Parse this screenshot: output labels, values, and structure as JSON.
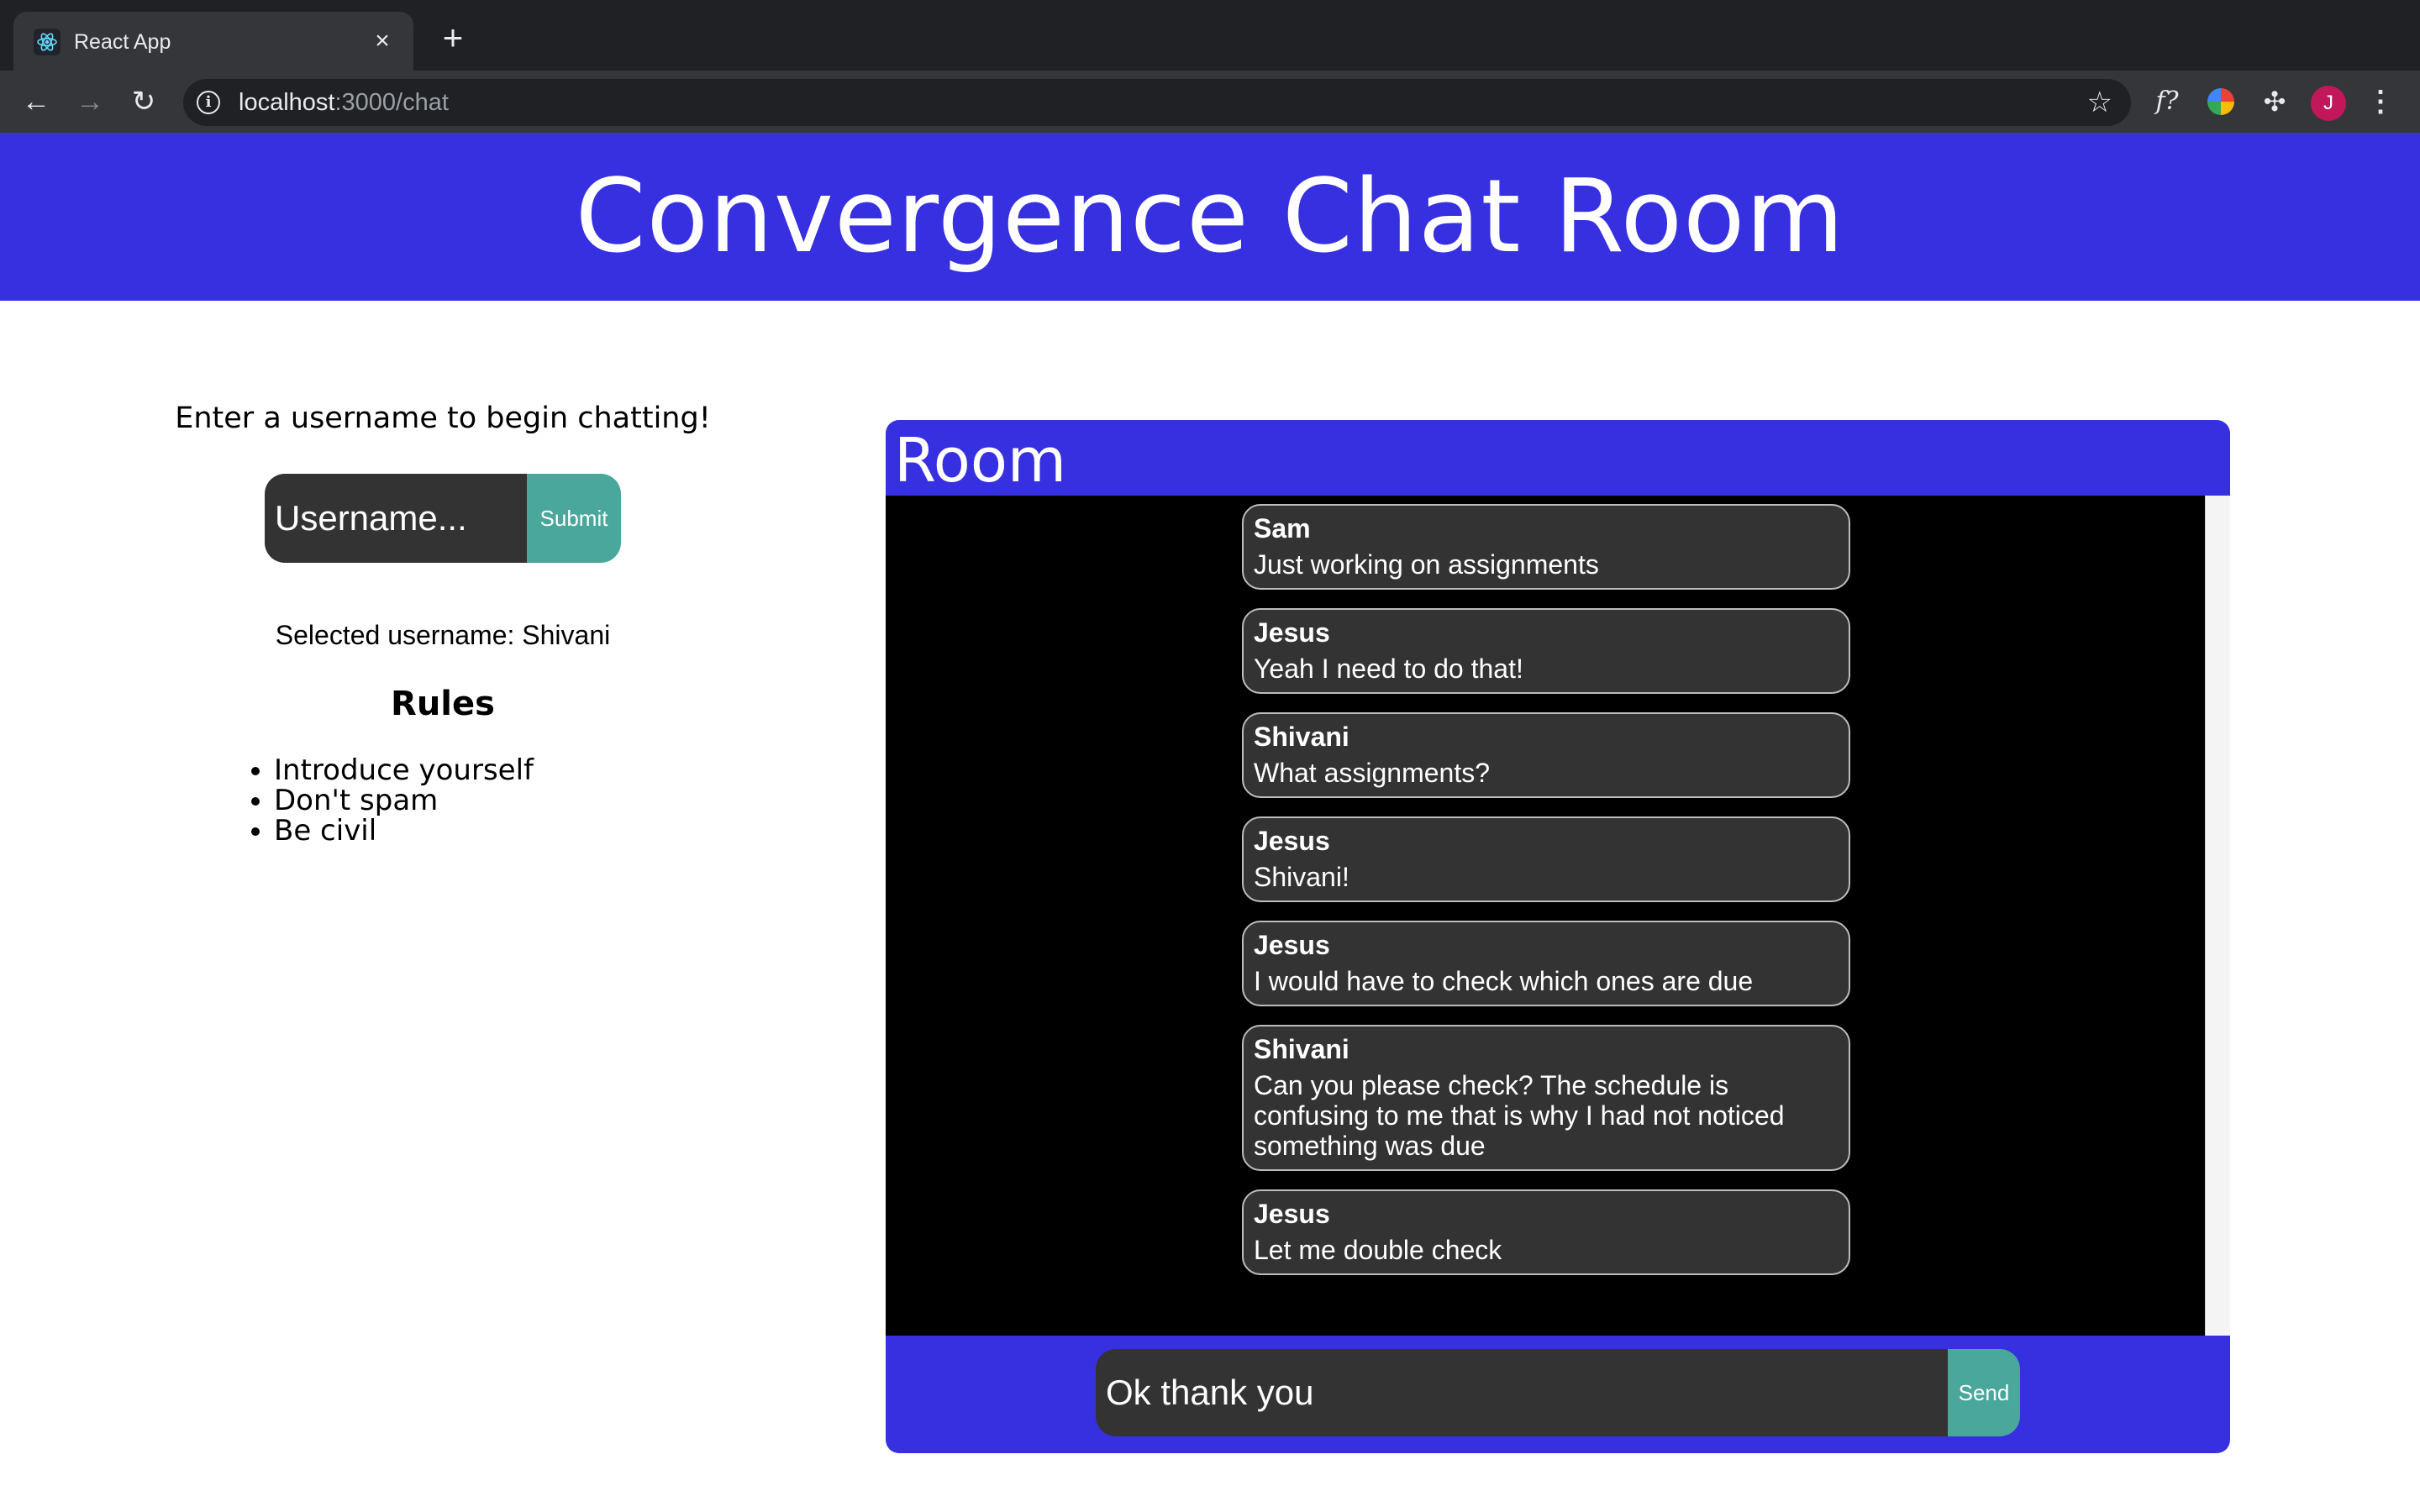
{
  "browser": {
    "tab_title": "React App",
    "tab_close_icon": "close-icon",
    "new_tab_icon": "plus-icon",
    "url_host": "localhost",
    "url_path": ":3000/chat",
    "avatar_letter": "J",
    "ext_f_label": "f?"
  },
  "header": {
    "title": "Convergence Chat Room"
  },
  "left": {
    "prompt": "Enter a username to begin chatting!",
    "username_placeholder": "Username...",
    "submit_label": "Submit",
    "selected_label": "Selected username: Shivani",
    "rules_title": "Rules",
    "rules": [
      "Introduce yourself",
      "Don't spam",
      "Be civil"
    ]
  },
  "room": {
    "title": "Room",
    "messages": [
      {
        "user": "Sam",
        "text": "Just working on assignments"
      },
      {
        "user": "Jesus",
        "text": "Yeah I need to do that!"
      },
      {
        "user": "Shivani",
        "text": "What assignments?"
      },
      {
        "user": "Jesus",
        "text": "Shivani!"
      },
      {
        "user": "Jesus",
        "text": "I would have to check which ones are due"
      },
      {
        "user": "Shivani",
        "text": "Can you please check? The schedule is confusing to me that is why I had not noticed something was due"
      },
      {
        "user": "Jesus",
        "text": "Let me double check"
      }
    ],
    "draft_value": "Ok thank you",
    "send_label": "Send"
  },
  "colors": {
    "brand": "#3730e0",
    "accent": "#4aa79b",
    "bubble": "#333333"
  }
}
